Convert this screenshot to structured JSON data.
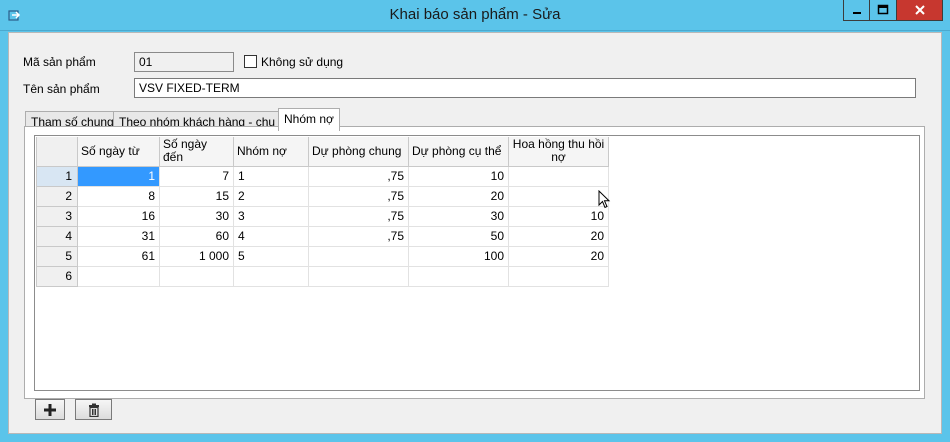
{
  "window": {
    "title": "Khai báo sản phẩm - Sửa"
  },
  "form": {
    "product_code_label": "Mã sản phẩm",
    "product_code_value": "01",
    "unused_label": "Không sử dụng",
    "product_name_label": "Tên sản phẩm",
    "product_name_value": "VSV FIXED-TERM"
  },
  "tabs": [
    {
      "label": "Tham số chung",
      "active": false
    },
    {
      "label": "Theo nhóm khách hàng - chu kỳ",
      "active": false
    },
    {
      "label": "Nhóm nợ",
      "active": true
    }
  ],
  "grid": {
    "columns": [
      "Số ngày từ",
      "Số ngày đến",
      "Nhóm nợ",
      "Dự phòng chung",
      "Dự phòng cụ thể",
      "Hoa hồng thu hồi nợ"
    ],
    "rows": [
      {
        "no": "1",
        "cells": [
          "1",
          "7",
          "1",
          ",75",
          "10",
          ""
        ]
      },
      {
        "no": "2",
        "cells": [
          "8",
          "15",
          "2",
          ",75",
          "20",
          ""
        ]
      },
      {
        "no": "3",
        "cells": [
          "16",
          "30",
          "3",
          ",75",
          "30",
          "10"
        ]
      },
      {
        "no": "4",
        "cells": [
          "31",
          "60",
          "4",
          ",75",
          "50",
          "20"
        ]
      },
      {
        "no": "5",
        "cells": [
          "61",
          "1 000",
          "5",
          "",
          "100",
          "20"
        ]
      },
      {
        "no": "6",
        "cells": [
          "",
          "",
          "",
          "",
          "",
          ""
        ]
      }
    ],
    "selected_row": 1
  },
  "icons": {
    "app": "app-icon",
    "minimize": "minimize-icon",
    "maximize": "maximize-icon",
    "close": "close-icon",
    "add": "plus-icon",
    "delete": "trash-icon"
  },
  "colors": {
    "titlebar": "#5bc4ea",
    "close_button": "#c7372f",
    "selection": "#3399ff"
  }
}
